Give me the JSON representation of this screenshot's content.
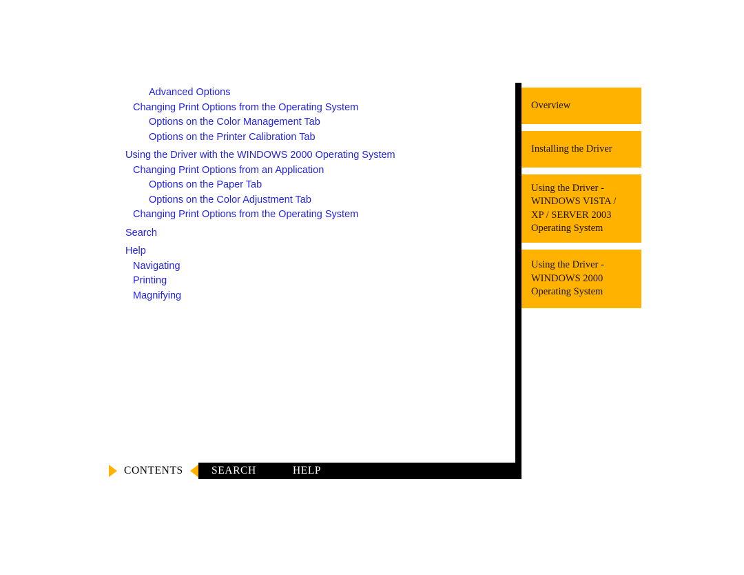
{
  "colors": {
    "link_blue": "#2222e8",
    "tab_orange": "#ffb300",
    "rail_black": "#000000",
    "bar_text_white": "#ffffff"
  },
  "toc": {
    "links": [
      {
        "label": "Advanced Options",
        "level": 3,
        "gap_before": false
      },
      {
        "label": "Changing Print Options from the Operating System",
        "level": 2,
        "gap_before": false
      },
      {
        "label": "Options on the Color Management Tab",
        "level": 3,
        "gap_before": false
      },
      {
        "label": "Options on the Printer Calibration Tab",
        "level": 3,
        "gap_before": false
      },
      {
        "label": "Using the Driver with the WINDOWS 2000 Operating System",
        "level": 1,
        "gap_before": true
      },
      {
        "label": "Changing Print Options from an Application",
        "level": 2,
        "gap_before": false
      },
      {
        "label": "Options on the Paper Tab",
        "level": 3,
        "gap_before": false
      },
      {
        "label": "Options on the Color Adjustment Tab",
        "level": 3,
        "gap_before": false
      },
      {
        "label": "Changing Print Options from the Operating System",
        "level": 2,
        "gap_before": false
      },
      {
        "label": "Search",
        "level": 1,
        "gap_before": true
      },
      {
        "label": "Help",
        "level": 1,
        "gap_before": true
      },
      {
        "label": "Navigating",
        "level": 2,
        "gap_before": false
      },
      {
        "label": "Printing",
        "level": 2,
        "gap_before": false
      },
      {
        "label": "Magnifying",
        "level": 2,
        "gap_before": false
      }
    ]
  },
  "sidebar": {
    "tabs": [
      {
        "lines": [
          "Overview"
        ]
      },
      {
        "lines": [
          "Installing the Driver"
        ]
      },
      {
        "lines": [
          "Using the Driver -",
          "WINDOWS VISTA /",
          "XP / SERVER 2003",
          "Operating System"
        ]
      },
      {
        "lines": [
          "Using the Driver -",
          "WINDOWS 2000",
          "Operating System"
        ]
      }
    ]
  },
  "bottombar": {
    "contents_label": "CONTENTS",
    "search_label": "SEARCH",
    "help_label": "HELP"
  }
}
